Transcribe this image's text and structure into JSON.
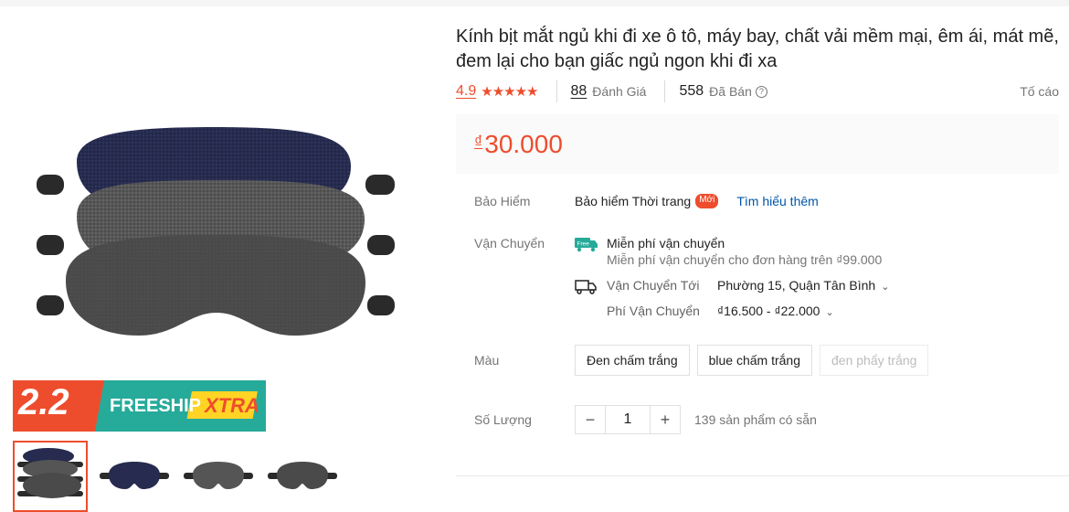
{
  "product": {
    "title": "Kính bịt mắt ngủ khi đi xe ô tô, máy bay, chất vải mềm mại, êm ái, mát mẽ, đem lại cho bạn giấc ngủ ngon khi đi xa",
    "rating": "4.9",
    "stars": "★★★★★",
    "reviews_count": "88",
    "reviews_label": "Đánh Giá",
    "sold_count": "558",
    "sold_label": "Đã Bán",
    "help_icon": "?",
    "report_label": "Tố cáo",
    "currency_symbol": "₫",
    "price": "30.000"
  },
  "banner": {
    "sale_date": "2.2",
    "freeship": "FREESHIP",
    "xtra": "XTRA"
  },
  "insurance": {
    "label": "Bảo Hiểm",
    "value": "Bảo hiểm Thời trang",
    "badge": "Mới",
    "link": "Tìm hiểu thêm"
  },
  "shipping": {
    "label": "Vận Chuyển",
    "free_icon_text": "Free",
    "free_title": "Miễn phí vận chuyển",
    "free_sub": "Miễn phí vận chuyển cho đơn hàng trên ₫99.000",
    "to_label": "Vận Chuyển Tới",
    "to_value": "Phường 15, Quận Tân Bình",
    "fee_label": "Phí Vận Chuyển",
    "fee_value": "₫16.500 - ₫22.000"
  },
  "color": {
    "label": "Màu",
    "options": [
      "Đen chấm trắng",
      "blue chấm trắng",
      "đen phẩy trắng"
    ]
  },
  "quantity": {
    "label": "Số Lượng",
    "minus": "−",
    "value": "1",
    "plus": "+",
    "stock": "139 sản phẩm có sẵn"
  },
  "colors": {
    "accent": "#ee4d2d",
    "link": "#0055aa",
    "teal": "#26aa99",
    "navy_mask": "#2a2f52",
    "gray_mask": "#4a4a4a"
  }
}
